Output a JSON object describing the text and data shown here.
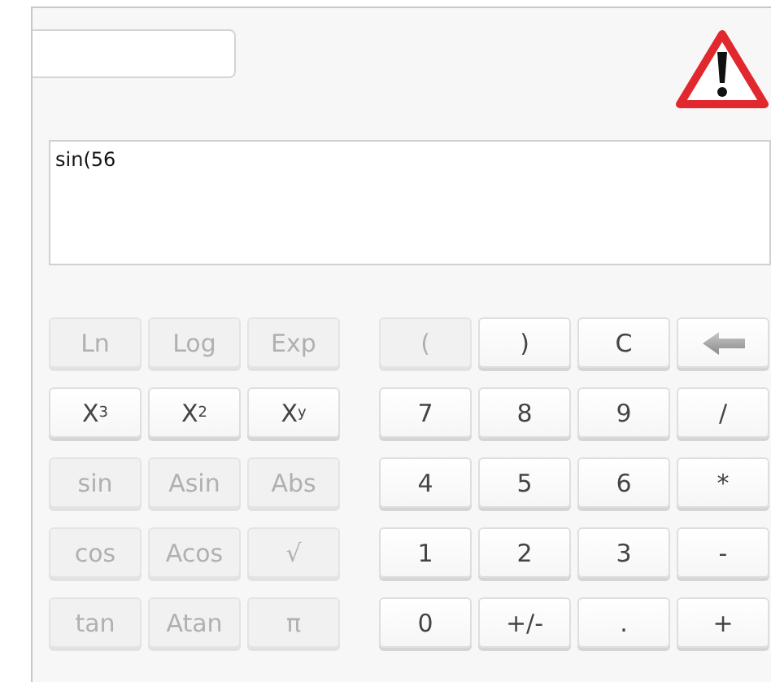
{
  "expression": {
    "value": "sin(56"
  },
  "warning": {
    "shown": true
  },
  "function_keys": [
    {
      "label": "Ln",
      "disabled": true
    },
    {
      "label": "Log",
      "disabled": true
    },
    {
      "label": "Exp",
      "disabled": true
    },
    {
      "label": "X$^{3}$",
      "disabled": false
    },
    {
      "label": "X$^{2}$",
      "disabled": false
    },
    {
      "label": "X$^{y}$",
      "disabled": false
    },
    {
      "label": "sin",
      "disabled": true
    },
    {
      "label": "Asin",
      "disabled": true
    },
    {
      "label": "Abs",
      "disabled": true
    },
    {
      "label": "cos",
      "disabled": true
    },
    {
      "label": "Acos",
      "disabled": true
    },
    {
      "label": "√",
      "disabled": true
    },
    {
      "label": "tan",
      "disabled": true
    },
    {
      "label": "Atan",
      "disabled": true
    },
    {
      "label": "π",
      "disabled": true
    }
  ],
  "number_keys": [
    {
      "kind": "text",
      "label": "(",
      "disabled": true
    },
    {
      "kind": "text",
      "label": ")",
      "disabled": false
    },
    {
      "kind": "text",
      "label": "C",
      "disabled": false
    },
    {
      "kind": "backspace",
      "disabled": false
    },
    {
      "kind": "text",
      "label": "7",
      "disabled": false
    },
    {
      "kind": "text",
      "label": "8",
      "disabled": false
    },
    {
      "kind": "text",
      "label": "9",
      "disabled": false
    },
    {
      "kind": "text",
      "label": "/",
      "disabled": false
    },
    {
      "kind": "text",
      "label": "4",
      "disabled": false
    },
    {
      "kind": "text",
      "label": "5",
      "disabled": false
    },
    {
      "kind": "text",
      "label": "6",
      "disabled": false
    },
    {
      "kind": "text",
      "label": "*",
      "disabled": false
    },
    {
      "kind": "text",
      "label": "1",
      "disabled": false
    },
    {
      "kind": "text",
      "label": "2",
      "disabled": false
    },
    {
      "kind": "text",
      "label": "3",
      "disabled": false
    },
    {
      "kind": "text",
      "label": "-",
      "disabled": false
    },
    {
      "kind": "text",
      "label": "0",
      "disabled": false
    },
    {
      "kind": "text",
      "label": "+/-",
      "disabled": false
    },
    {
      "kind": "text",
      "label": ".",
      "disabled": false
    },
    {
      "kind": "text",
      "label": "+",
      "disabled": false
    }
  ]
}
